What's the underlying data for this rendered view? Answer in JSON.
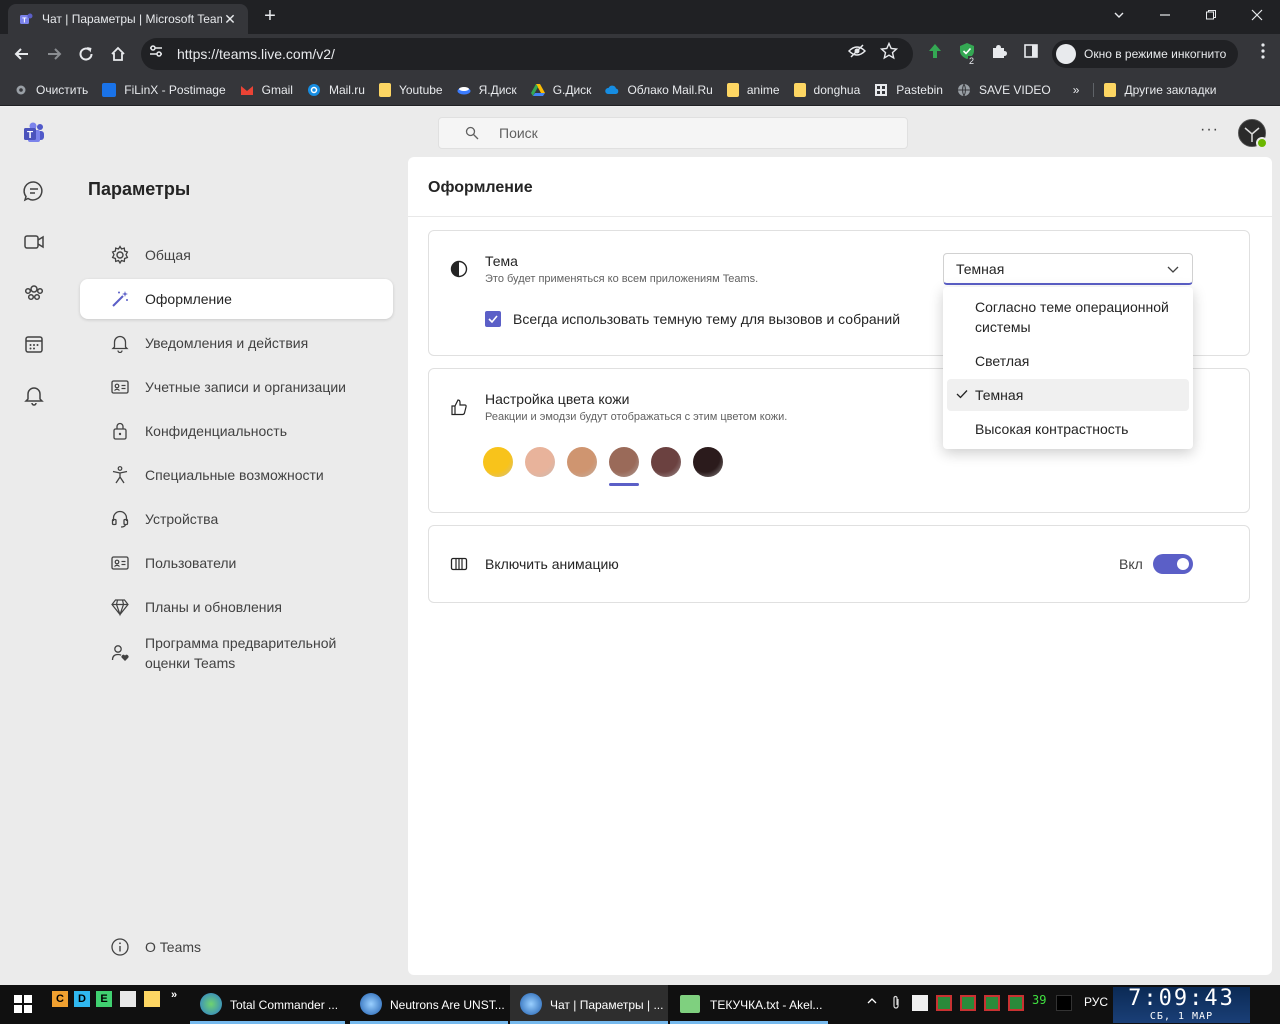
{
  "browser": {
    "tab_title": "Чат | Параметры | Microsoft Teams",
    "url": "https://teams.live.com/v2/",
    "incognito_label": "Окно в режиме инкогнито",
    "extension_badge": "2",
    "bookmarks": [
      {
        "label": "Очистить",
        "icon": "gear-icon",
        "color": "#9aa0a6"
      },
      {
        "label": "FiLinX - Postimage",
        "icon": "postimage-icon",
        "color": "#1a73e8"
      },
      {
        "label": "Gmail",
        "icon": "gmail-icon",
        "color": "#ea4335"
      },
      {
        "label": "Mail.ru",
        "icon": "mailru-icon",
        "color": "#168de2"
      },
      {
        "label": "Youtube",
        "icon": "folder-icon",
        "color": "#fdd663"
      },
      {
        "label": "Я.Диск",
        "icon": "yadisk-icon",
        "color": "#3b7cff"
      },
      {
        "label": "G.Диск",
        "icon": "gdrive-icon",
        "color": "#34a853"
      },
      {
        "label": "Облако Mail.Ru",
        "icon": "cloud-icon",
        "color": "#168de2"
      },
      {
        "label": "anime",
        "icon": "folder-icon",
        "color": "#fdd663"
      },
      {
        "label": "donghua",
        "icon": "folder-icon",
        "color": "#fdd663"
      },
      {
        "label": "Pastebin",
        "icon": "pastebin-icon",
        "color": "#e8eaed"
      },
      {
        "label": "SAVE VIDEO",
        "icon": "globe-icon",
        "color": "#9aa0a6"
      }
    ],
    "more_bookmarks": "»",
    "other_bookmarks": "Другие закладки"
  },
  "teams": {
    "search_placeholder": "Поиск",
    "more_label": "···",
    "settings_title": "Параметры",
    "nav": [
      {
        "label": "Общая",
        "icon": "gear-icon"
      },
      {
        "label": "Оформление",
        "icon": "magic-wand-icon"
      },
      {
        "label": "Уведомления и действия",
        "icon": "bell-icon"
      },
      {
        "label": "Учетные записи и организации",
        "icon": "id-card-icon"
      },
      {
        "label": "Конфиденциальность",
        "icon": "lock-icon"
      },
      {
        "label": "Специальные возможности",
        "icon": "accessibility-icon"
      },
      {
        "label": "Устройства",
        "icon": "headset-icon"
      },
      {
        "label": "Пользователи",
        "icon": "contact-card-icon"
      },
      {
        "label": "Планы и обновления",
        "icon": "diamond-icon"
      },
      {
        "label": "Программа предварительной оценки Teams",
        "icon": "person-heart-icon"
      }
    ],
    "about": "О Teams",
    "page_title": "Оформление",
    "theme": {
      "title": "Тема",
      "subtitle": "Это будет применяться ко всем приложениям Teams.",
      "selected": "Темная",
      "always_dark_label": "Всегда использовать темную тему для вызовов и собраний",
      "always_dark_checked": true,
      "options": [
        "Согласно теме операционной системы",
        "Светлая",
        "Темная",
        "Высокая контрастность"
      ]
    },
    "skin": {
      "title": "Настройка цвета кожи",
      "subtitle": "Реакции и эмодзи будут отображаться с этим цветом кожи.",
      "tones": [
        "#f8c31b",
        "#e8b39b",
        "#cf9570",
        "#9a6a59",
        "#6b4140",
        "#2b1b1c"
      ],
      "selected_index": 3
    },
    "animation": {
      "title": "Включить анимацию",
      "state_label": "Вкл",
      "enabled": true
    },
    "accent_color": "#5b5fc7"
  },
  "taskbar": {
    "quick_launch": [
      "C",
      "D",
      "E"
    ],
    "overflow": "»",
    "windows": [
      {
        "label": "Total Commander ..."
      },
      {
        "label": "Neutrons Are UNST..."
      },
      {
        "label": "Чат | Параметры | ..."
      },
      {
        "label": "ТЕКУЧКА.txt - Akel..."
      }
    ],
    "tray_counter": "39",
    "language": "РУС",
    "time": "7:09:43",
    "date": "СБ, 1  МАР"
  }
}
